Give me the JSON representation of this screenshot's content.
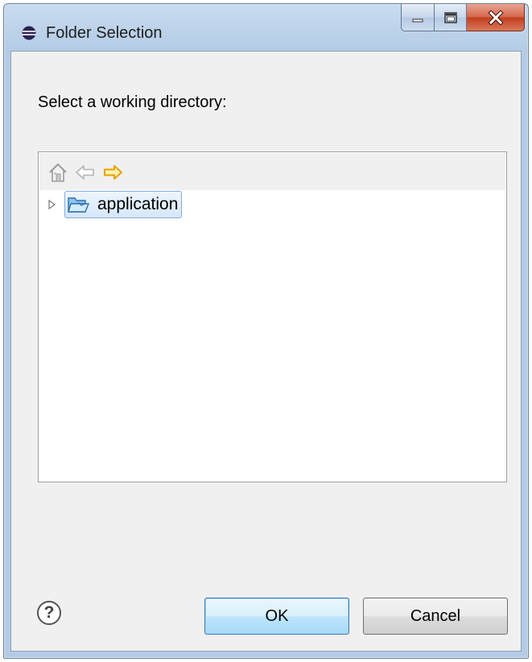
{
  "window": {
    "title": "Folder Selection",
    "icon": "eclipse-icon"
  },
  "caption_buttons": {
    "minimize_icon": "minimize-icon",
    "maximize_icon": "maximize-icon",
    "close_icon": "close-icon"
  },
  "dialog": {
    "prompt": "Select a working directory:"
  },
  "tree": {
    "toolbar": {
      "home_icon": "home-icon",
      "back_icon": "back-arrow-icon",
      "forward_icon": "forward-arrow-icon"
    },
    "items": [
      {
        "label": "application",
        "icon": "open-folder-icon",
        "selected": true,
        "expandable": true
      }
    ]
  },
  "buttons": {
    "help_label": "?",
    "ok_label": "OK",
    "cancel_label": "Cancel"
  },
  "colors": {
    "close_button": "#c2401f",
    "selection": "#d5e7fb",
    "forward_arrow": "#f0b400"
  }
}
